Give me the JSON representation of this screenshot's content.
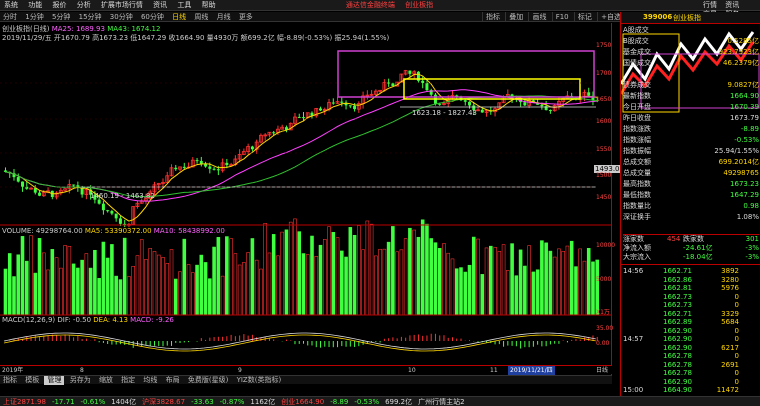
{
  "menubar": {
    "items": [
      "系统",
      "功能",
      "报价",
      "分析",
      "扩展市场行情",
      "资讯",
      "工具",
      "帮助"
    ],
    "promo": [
      "通达信金融终端",
      "创业板指"
    ],
    "right": [
      "行情",
      "资讯",
      "交易",
      "服务"
    ]
  },
  "periods": [
    "分时",
    "1分钟",
    "5分钟",
    "15分钟",
    "30分钟",
    "60分钟",
    "日线",
    "周线",
    "月线",
    "更多"
  ],
  "selected_period": "日线",
  "tools": [
    "指标",
    "叠加",
    "画线",
    "F10",
    "标记",
    "+自选",
    "返回"
  ],
  "info": {
    "title": "创业板指(日线)",
    "ma25": "MA25: 1689.93",
    "ma43": "MA43: 1674.12",
    "bar": "2019/11/29/五 开1670.79 高1673.23 低1647.29 收1664.90 量4930万 额699.2亿 幅-8.89(-0.53%) 振25.94(1.55%)"
  },
  "annotations": {
    "range_high": "1623.18 - 1827.43",
    "range_low": "1460.19 - 1463.82",
    "price_tag": "1493.0"
  },
  "volume": {
    "label": "VOLUME: 49298764.00",
    "ma5": "MA5: 53390372.00",
    "ma10": "MA10: 58438992.00",
    "axis": [
      "10000",
      "5000",
      "X1万"
    ]
  },
  "macd": {
    "label": "MACD(12,26,9)",
    "dif": "DIF: -0.50",
    "dea": "DEA: 4.13",
    "macd": "MACD: -9.26",
    "axis": [
      "35.00",
      "0.00"
    ]
  },
  "price_axis": [
    "1750",
    "1700",
    "1650",
    "1600",
    "1550",
    "1500",
    "1450"
  ],
  "xaxis": {
    "labels": [
      "2019年",
      "8",
      "9",
      "10",
      "11"
    ],
    "current_date": "2019/11/21/四",
    "mode": "日线"
  },
  "bottomtabs": [
    "指标",
    "模板",
    "管理",
    "另存为",
    "缩放",
    "指定",
    "均线",
    "布局",
    "免费版(星级)",
    "YIZ数(类指标)"
  ],
  "bottomtab_selected": "管理",
  "right": {
    "code": "399006",
    "name": "创业板指",
    "stats": [
      {
        "label": "A股成交",
        "value": "",
        "cls": "w"
      },
      {
        "label": "B股成交",
        "value": "0.5285亿",
        "cls": "y"
      },
      {
        "label": "基金成交",
        "value": "923.7923亿",
        "cls": "y"
      },
      {
        "label": "国债成交",
        "value": "46.2379亿",
        "cls": "y"
      },
      {
        "label": "",
        "value": "",
        "cls": "w"
      },
      {
        "label": "债券成交",
        "value": "9.0827亿",
        "cls": "y"
      },
      {
        "label": "最新指数",
        "value": "1664.90",
        "cls": "g"
      },
      {
        "label": "今日开盘",
        "value": "1670.39",
        "cls": "g"
      },
      {
        "label": "昨日收盘",
        "value": "1673.79",
        "cls": "w"
      },
      {
        "label": "指数涨跌",
        "value": "-8.89",
        "cls": "g"
      },
      {
        "label": "指数涨幅",
        "value": "-0.53%",
        "cls": "g"
      },
      {
        "label": "指数振幅",
        "value": "25.94/1.55%",
        "cls": "w"
      },
      {
        "label": "总成交额",
        "value": "699.2014亿",
        "cls": "y"
      },
      {
        "label": "总成交量",
        "value": "49298765",
        "cls": "y"
      },
      {
        "label": "最高指数",
        "value": "1673.23",
        "cls": "g"
      },
      {
        "label": "最低指数",
        "value": "1647.29",
        "cls": "g"
      },
      {
        "label": "指数量比",
        "value": "0.98",
        "cls": "g"
      },
      {
        "label": "深证换手",
        "value": "1.08%",
        "cls": "w"
      }
    ],
    "updown": {
      "up_label": "涨家数",
      "up": "454",
      "down_label": "跌家数",
      "down": "301"
    },
    "flow": [
      {
        "label": "净流入额",
        "value": "-24.61亿",
        "pct": "-3%"
      },
      {
        "label": "大宗流入",
        "value": "-18.04亿",
        "pct": "-3%"
      }
    ],
    "ticks": [
      {
        "time": "14:56",
        "price": "1662.71",
        "vol": "3892"
      },
      {
        "time": "",
        "price": "1662.86",
        "vol": "3280"
      },
      {
        "time": "",
        "price": "1662.81",
        "vol": "5976"
      },
      {
        "time": "",
        "price": "1662.73",
        "vol": "0"
      },
      {
        "time": "",
        "price": "1662.73",
        "vol": "0"
      },
      {
        "time": "",
        "price": "1662.71",
        "vol": "3329"
      },
      {
        "time": "",
        "price": "1662.89",
        "vol": "5684"
      },
      {
        "time": "",
        "price": "1662.90",
        "vol": "0"
      },
      {
        "time": "14:57",
        "price": "1662.90",
        "vol": "0"
      },
      {
        "time": "",
        "price": "1662.90",
        "vol": "6217"
      },
      {
        "time": "",
        "price": "1662.78",
        "vol": "0"
      },
      {
        "time": "",
        "price": "1662.78",
        "vol": "2691"
      },
      {
        "time": "",
        "price": "1662.78",
        "vol": "0"
      },
      {
        "time": "",
        "price": "1662.90",
        "vol": "0"
      },
      {
        "time": "15:00",
        "price": "1664.90",
        "vol": "11472"
      }
    ]
  },
  "statusbar": [
    {
      "text": "上证2871.98",
      "cls": "r"
    },
    {
      "text": "-17.71",
      "cls": "g"
    },
    {
      "text": "-0.61%",
      "cls": "g"
    },
    {
      "text": "1404亿",
      "cls": "w"
    },
    {
      "text": "沪深3828.67",
      "cls": "r"
    },
    {
      "text": "-33.63",
      "cls": "g"
    },
    {
      "text": "-0.87%",
      "cls": "g"
    },
    {
      "text": "1162亿",
      "cls": "w"
    },
    {
      "text": "创业1664.90",
      "cls": "r"
    },
    {
      "text": "-8.89",
      "cls": "g"
    },
    {
      "text": "-0.53%",
      "cls": "g"
    },
    {
      "text": "699.2亿",
      "cls": "w"
    },
    {
      "text": "广州行情主站2",
      "cls": "w"
    }
  ],
  "colors": {
    "up": "#ff3030",
    "down": "#40ff40",
    "ma_yellow": "#ffd700",
    "ma_magenta": "#ff40ff",
    "ma_green": "#30c030",
    "box_magenta": "#d040d0",
    "box_yellow": "#ffff00"
  }
}
